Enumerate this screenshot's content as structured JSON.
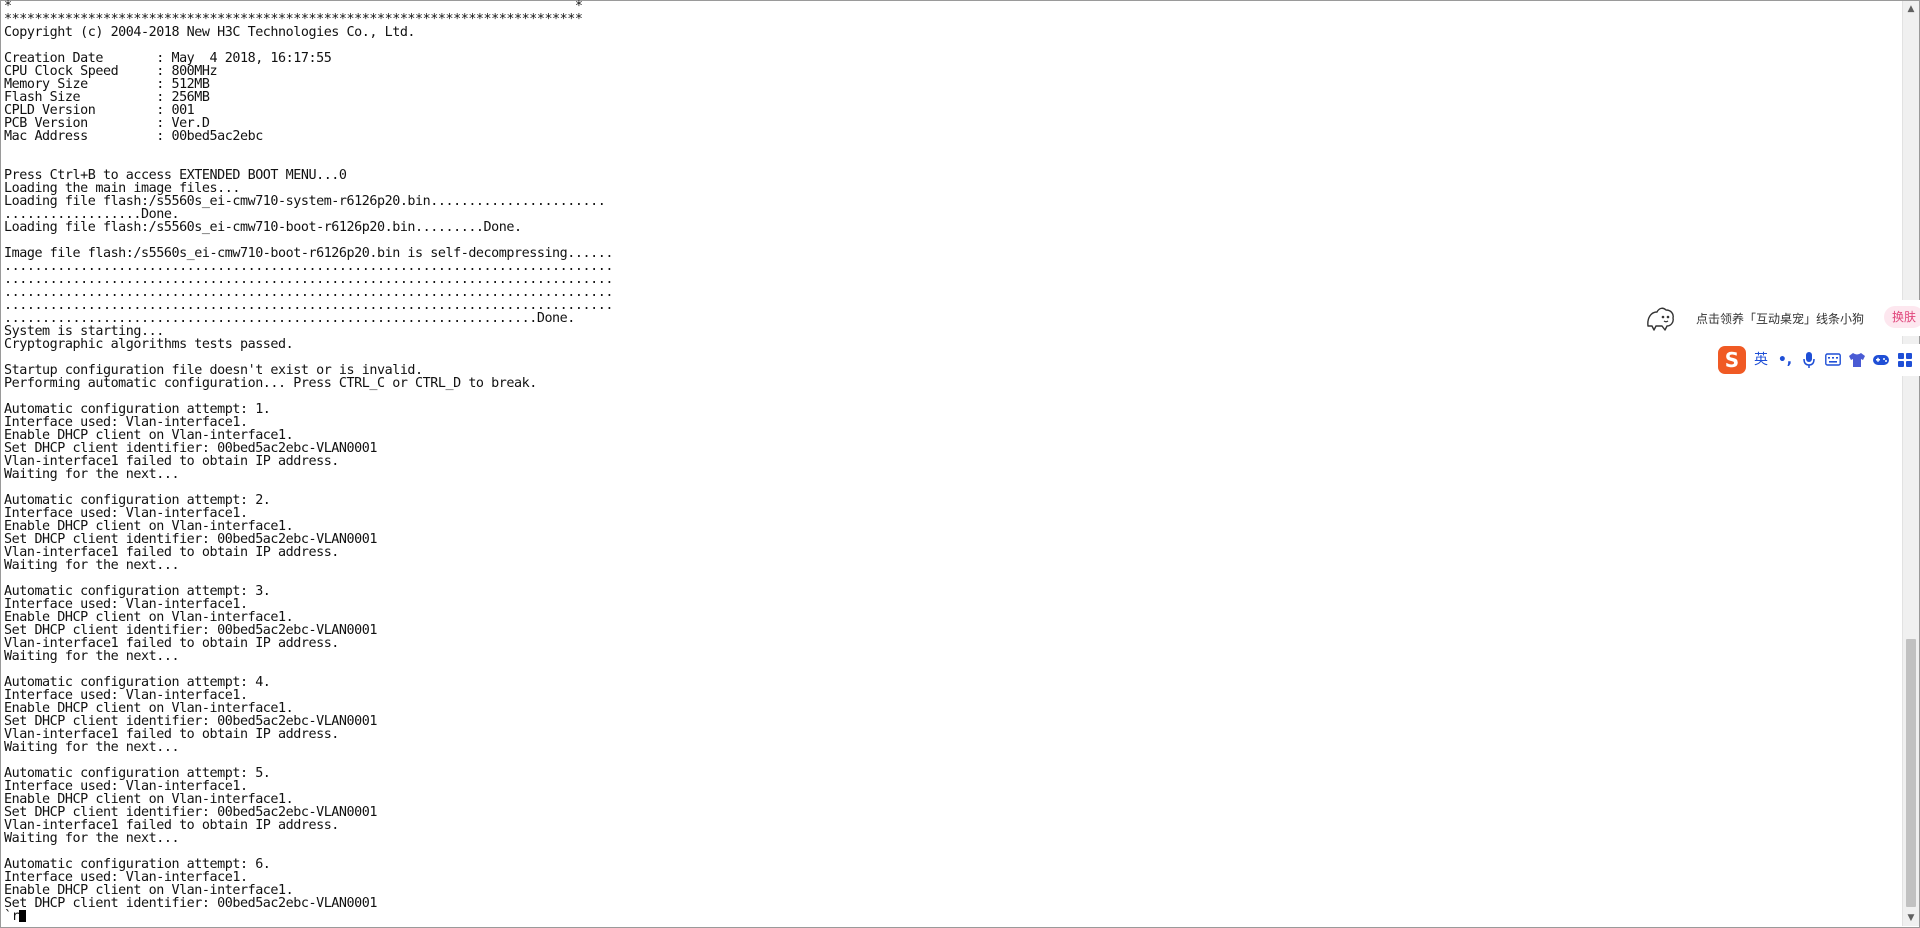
{
  "terminal": {
    "lines": [
      "*                                                                          *",
      "****************************************************************************",
      "Copyright (c) 2004-2018 New H3C Technologies Co., Ltd.",
      "",
      "Creation Date       : May  4 2018, 16:17:55",
      "CPU Clock Speed     : 800MHz",
      "Memory Size         : 512MB",
      "Flash Size          : 256MB",
      "CPLD Version        : 001",
      "PCB Version         : Ver.D",
      "Mac Address         : 00bed5ac2ebc",
      "",
      "",
      "Press Ctrl+B to access EXTENDED BOOT MENU...0",
      "Loading the main image files...",
      "Loading file flash:/s5560s_ei-cmw710-system-r6126p20.bin.......................",
      "..................Done.",
      "Loading file flash:/s5560s_ei-cmw710-boot-r6126p20.bin.........Done.",
      "",
      "Image file flash:/s5560s_ei-cmw710-boot-r6126p20.bin is self-decompressing......",
      "................................................................................",
      "................................................................................",
      "................................................................................",
      "................................................................................",
      "......................................................................Done.",
      "System is starting...",
      "Cryptographic algorithms tests passed.",
      "",
      "Startup configuration file doesn't exist or is invalid.",
      "Performing automatic configuration... Press CTRL_C or CTRL_D to break.",
      "",
      "Automatic configuration attempt: 1.",
      "Interface used: Vlan-interface1.",
      "Enable DHCP client on Vlan-interface1.",
      "Set DHCP client identifier: 00bed5ac2ebc-VLAN0001",
      "Vlan-interface1 failed to obtain IP address.",
      "Waiting for the next...",
      "",
      "Automatic configuration attempt: 2.",
      "Interface used: Vlan-interface1.",
      "Enable DHCP client on Vlan-interface1.",
      "Set DHCP client identifier: 00bed5ac2ebc-VLAN0001",
      "Vlan-interface1 failed to obtain IP address.",
      "Waiting for the next...",
      "",
      "Automatic configuration attempt: 3.",
      "Interface used: Vlan-interface1.",
      "Enable DHCP client on Vlan-interface1.",
      "Set DHCP client identifier: 00bed5ac2ebc-VLAN0001",
      "Vlan-interface1 failed to obtain IP address.",
      "Waiting for the next...",
      "",
      "Automatic configuration attempt: 4.",
      "Interface used: Vlan-interface1.",
      "Enable DHCP client on Vlan-interface1.",
      "Set DHCP client identifier: 00bed5ac2ebc-VLAN0001",
      "Vlan-interface1 failed to obtain IP address.",
      "Waiting for the next...",
      "",
      "Automatic configuration attempt: 5.",
      "Interface used: Vlan-interface1.",
      "Enable DHCP client on Vlan-interface1.",
      "Set DHCP client identifier: 00bed5ac2ebc-VLAN0001",
      "Vlan-interface1 failed to obtain IP address.",
      "Waiting for the next...",
      "",
      "Automatic configuration attempt: 6.",
      "Interface used: Vlan-interface1.",
      "Enable DHCP client on Vlan-interface1.",
      "Set DHCP client identifier: 00bed5ac2ebc-VLAN0001"
    ],
    "prompt": "`r"
  },
  "ime_notice": {
    "text": "点击领养「互动桌宠」线条小狗",
    "skin_label": "换肤",
    "icon": "pet-dog-icon"
  },
  "ime_toolbar": {
    "logo": "S",
    "lang_label": "英",
    "punct_label": "•,",
    "icons": [
      "sogou-logo-icon",
      "punctuation-icon",
      "microphone-icon",
      "keyboard-icon",
      "skin-shirt-icon",
      "game-controller-icon",
      "toolbox-grid-icon"
    ],
    "accent": "#f05a24",
    "icon_color": "#1f4fd6"
  }
}
